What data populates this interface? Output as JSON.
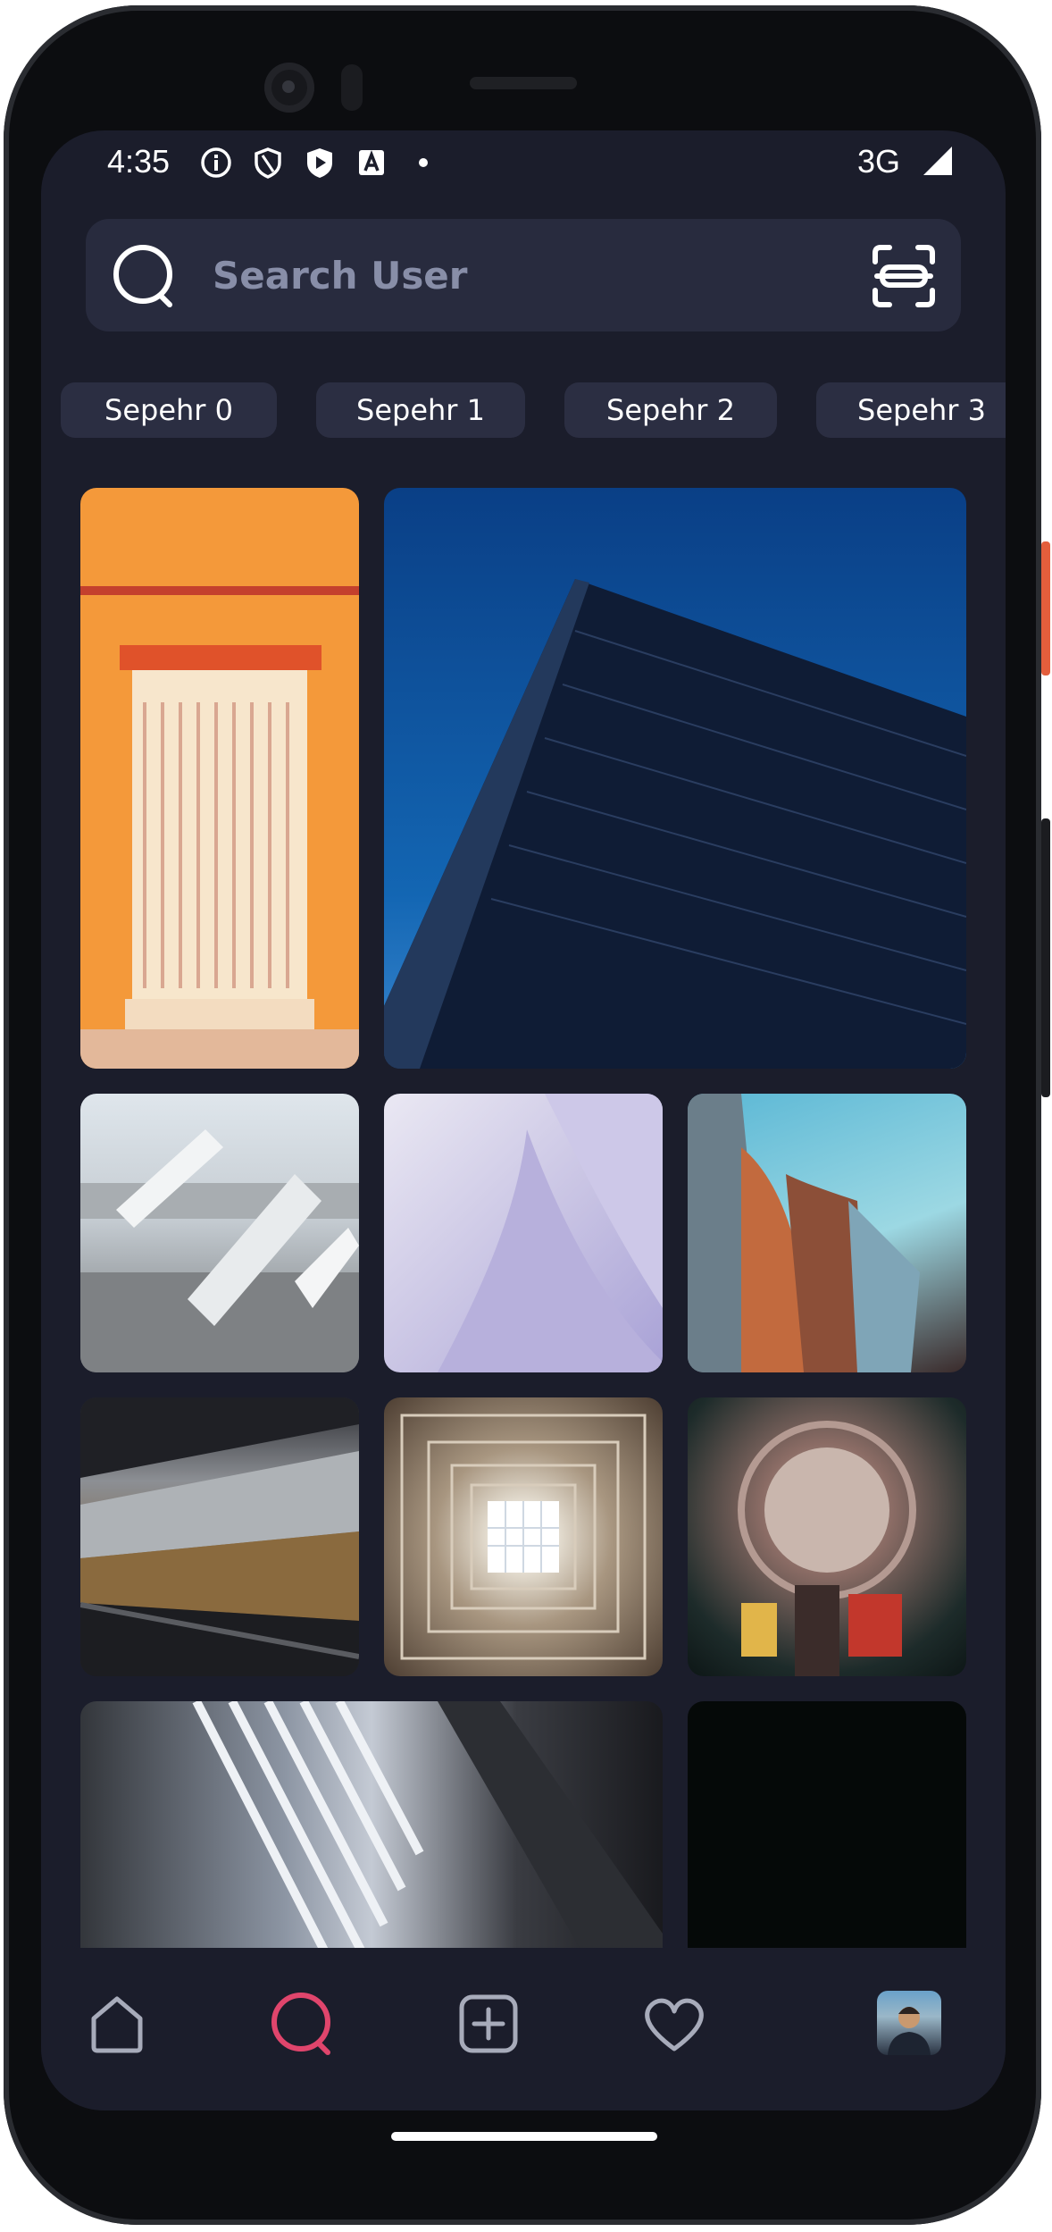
{
  "status_bar": {
    "time": "4:35",
    "network": "3G",
    "icons": [
      "info-icon",
      "shield-icon",
      "play-protect-icon",
      "a-icon",
      "dot-icon",
      "signal-icon"
    ]
  },
  "search": {
    "placeholder": "Search User",
    "value": "",
    "leading_icon": "search-icon",
    "trailing_icon": "scan-icon"
  },
  "chips": [
    {
      "label": "Sepehr 0"
    },
    {
      "label": "Sepehr 1"
    },
    {
      "label": "Sepehr 2"
    },
    {
      "label": "Sepehr 3"
    }
  ],
  "grid": {
    "tiles": [
      {
        "name": "orange-door-photo"
      },
      {
        "name": "blue-building-photo"
      },
      {
        "name": "concrete-structure-photo"
      },
      {
        "name": "purple-curves-photo"
      },
      {
        "name": "metal-building-photo"
      },
      {
        "name": "forest-window-photo"
      },
      {
        "name": "skylight-photo"
      },
      {
        "name": "dome-interior-photo"
      },
      {
        "name": "stairs-photo"
      },
      {
        "name": "dark-photo"
      }
    ]
  },
  "bottom_nav": {
    "items": [
      "home-icon",
      "search-icon",
      "add-post-icon",
      "heart-icon",
      "profile-avatar"
    ],
    "active": "search-icon",
    "active_color": "#e0456c"
  },
  "colors": {
    "background": "#1b1d2b",
    "search_bg": "#282b3e",
    "chip_bg": "#2b2e42",
    "accent": "#e0456c"
  }
}
